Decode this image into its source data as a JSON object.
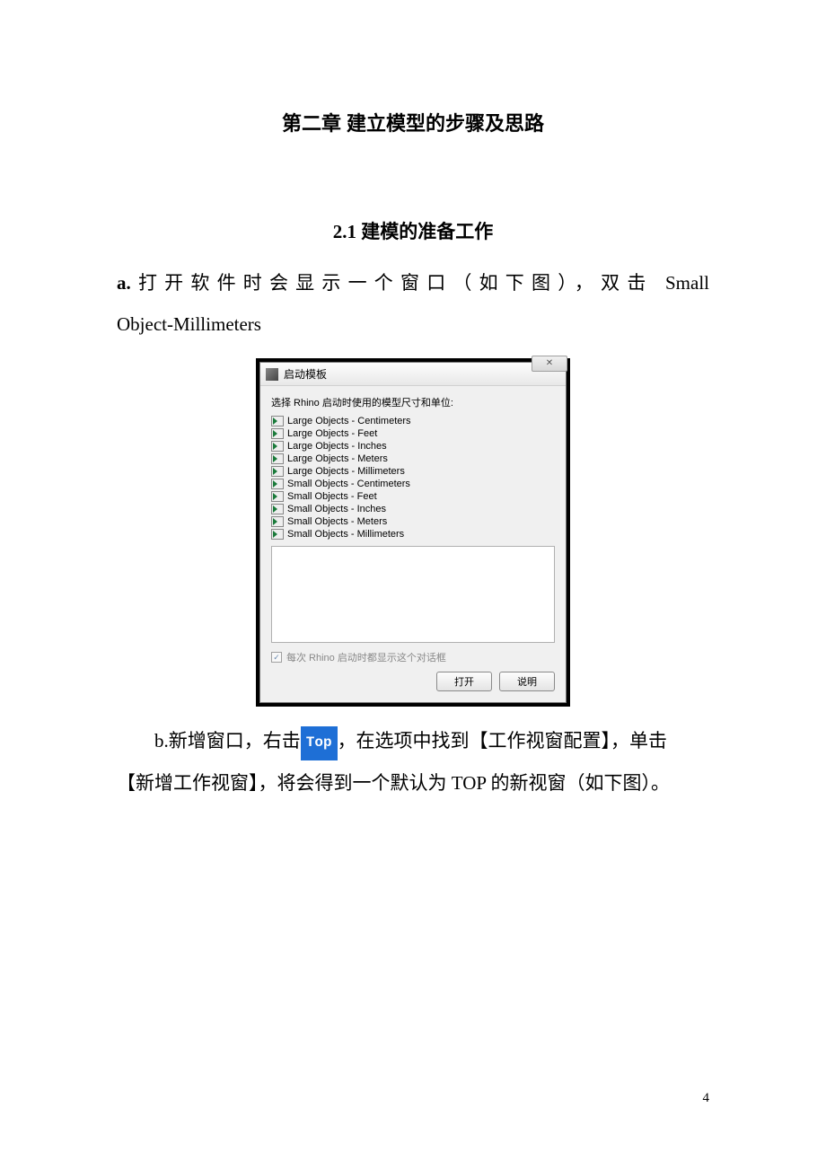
{
  "chapter_title": "第二章 建立模型的步骤及思路",
  "section_title": "2.1 建模的准备工作",
  "para_a_prefix": "a.",
  "para_a_text": "打开软件时会显示一个窗口（如下图），双击",
  "para_a_tail": "Small",
  "para_a_line2": "Object-Millimeters",
  "dialog": {
    "title": "启动模板",
    "close_glyph": "✕",
    "prompt": "选择 Rhino 启动时使用的模型尺寸和单位:",
    "templates": [
      "Large Objects - Centimeters",
      "Large Objects - Feet",
      "Large Objects - Inches",
      "Large Objects - Meters",
      "Large Objects - Millimeters",
      "Small Objects - Centimeters",
      "Small Objects - Feet",
      "Small Objects - Inches",
      "Small Objects - Meters",
      "Small Objects - Millimeters"
    ],
    "checkbox_label": "每次 Rhino 启动时都显示这个对话框",
    "checkbox_mark": "✓",
    "btn_open": "打开",
    "btn_help": "说明"
  },
  "para_b_prefix": "b.新增窗口，右击",
  "top_badge": "Top",
  "para_b_suffix": "，在选项中找到【工作视窗配置】，单击",
  "para_b_line2": "【新增工作视窗】，将会得到一个默认为 TOP 的新视窗（如下图）。",
  "page_number": "4"
}
